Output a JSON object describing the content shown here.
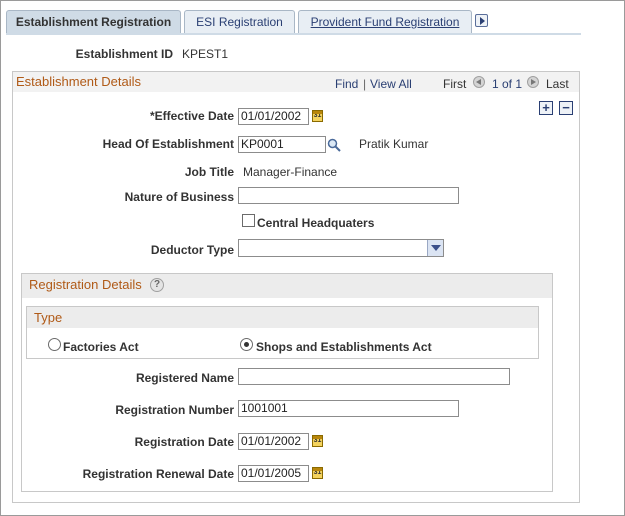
{
  "tabs": [
    {
      "label": "Establishment Registration",
      "active": true
    },
    {
      "label": "ESI Registration",
      "underline": "R"
    },
    {
      "label": "Provident Fund Registration",
      "underline": "P"
    }
  ],
  "establishment_id": {
    "label": "Establishment ID",
    "value": "KPEST1"
  },
  "establishment_details": {
    "title": "Establishment Details",
    "find": "Find",
    "separator": "|",
    "view_all": "View All",
    "first": "First",
    "page_info": "1 of 1",
    "last": "Last",
    "add_symbol": "+",
    "remove_symbol": "−"
  },
  "fields": {
    "effective_date": {
      "label": "*Effective Date",
      "value": "01/01/2002"
    },
    "head": {
      "label": "Head Of Establishment",
      "value": "KP0001",
      "name": "Pratik Kumar"
    },
    "job_title": {
      "label": "Job Title",
      "value": "Manager-Finance"
    },
    "nature": {
      "label": "Nature of Business",
      "value": ""
    },
    "central_hq": {
      "label": "Central Headquaters",
      "checked": false
    },
    "deductor_type": {
      "label": "Deductor Type",
      "value": ""
    }
  },
  "registration_details": {
    "title": "Registration Details",
    "help": "?",
    "type_title": "Type",
    "factories_act": {
      "label": "Factories Act",
      "selected": false
    },
    "shops_act": {
      "label": "Shops and Establishments Act",
      "selected": true
    },
    "registered_name": {
      "label": "Registered Name",
      "value": ""
    },
    "registration_number": {
      "label": "Registration Number",
      "value": "1001001"
    },
    "registration_date": {
      "label": "Registration Date",
      "value": "01/01/2002"
    },
    "renewal_date": {
      "label": "Registration Renewal Date",
      "value": "01/01/2005"
    }
  },
  "colors": {
    "section_title": "#b05a17",
    "link": "#2a3f73",
    "tab_active": "#cfdbe6"
  },
  "calendar_glyph": "31"
}
